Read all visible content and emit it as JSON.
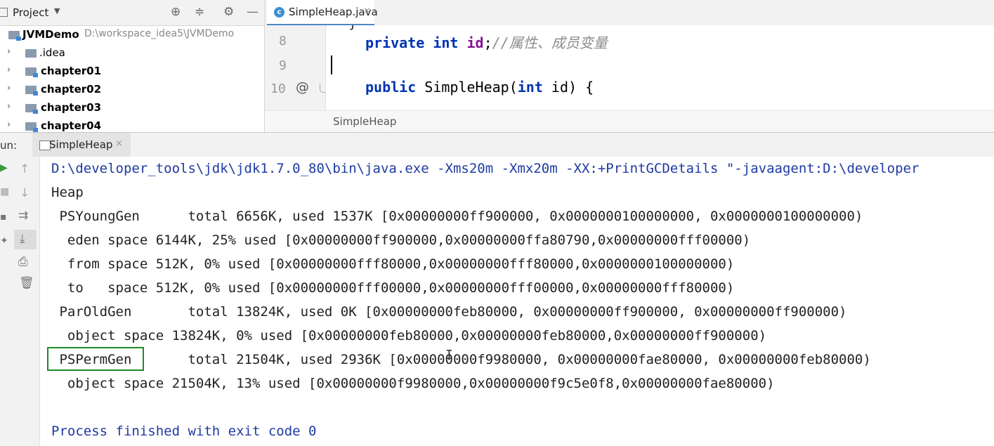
{
  "project": {
    "title": "Project",
    "root_name": "JVMDemo",
    "root_path": "D:\\workspace_idea5\\JVMDemo",
    "items": [
      {
        "label": ".idea"
      },
      {
        "label": "chapter01"
      },
      {
        "label": "chapter02"
      },
      {
        "label": "chapter03"
      },
      {
        "label": "chapter04"
      }
    ]
  },
  "editor": {
    "tab_label": "SimpleHeap.java",
    "breadcrumb": "SimpleHeap",
    "lines": [
      {
        "num": "8",
        "kw": "private int",
        "field": "id",
        "punct": ";",
        "comment": "//属性、成员变量"
      },
      {
        "num": "9"
      },
      {
        "num": "10",
        "kw": "public",
        "text": " SimpleHeap(",
        "kw2": "int",
        "text2": " id) {"
      }
    ]
  },
  "run": {
    "label": "un:",
    "tab_label": "SimpleHeap",
    "console_lines": [
      "D:\\developer_tools\\jdk\\jdk1.7.0_80\\bin\\java.exe -Xms20m -Xmx20m -XX:+PrintGCDetails \"-javaagent:D:\\developer",
      "Heap",
      " PSYoungGen      total 6656K, used 1537K [0x00000000ff900000, 0x0000000100000000, 0x0000000100000000)",
      "  eden space 6144K, 25% used [0x00000000ff900000,0x00000000ffa80790,0x00000000fff00000)",
      "  from space 512K, 0% used [0x00000000fff80000,0x00000000fff80000,0x0000000100000000)",
      "  to   space 512K, 0% used [0x00000000fff00000,0x00000000fff00000,0x00000000fff80000)",
      " ParOldGen       total 13824K, used 0K [0x00000000feb80000, 0x00000000ff900000, 0x00000000ff900000)",
      "  object space 13824K, 0% used [0x00000000feb80000,0x00000000feb80000,0x00000000ff900000)",
      " PSPermGen       total 21504K, used 2936K [0x00000000f9980000, 0x00000000fae80000, 0x00000000feb80000)",
      "  object space 21504K, 13% used [0x00000000f9980000,0x00000000f9c5e0f8,0x00000000fae80000)",
      "",
      "Process finished with exit code 0"
    ]
  },
  "colors": {
    "highlight_box": "#1f8a2a",
    "command_text": "#1f3aa3",
    "keyword": "#0033b3",
    "field": "#871094",
    "comment": "#8c8c8c"
  }
}
